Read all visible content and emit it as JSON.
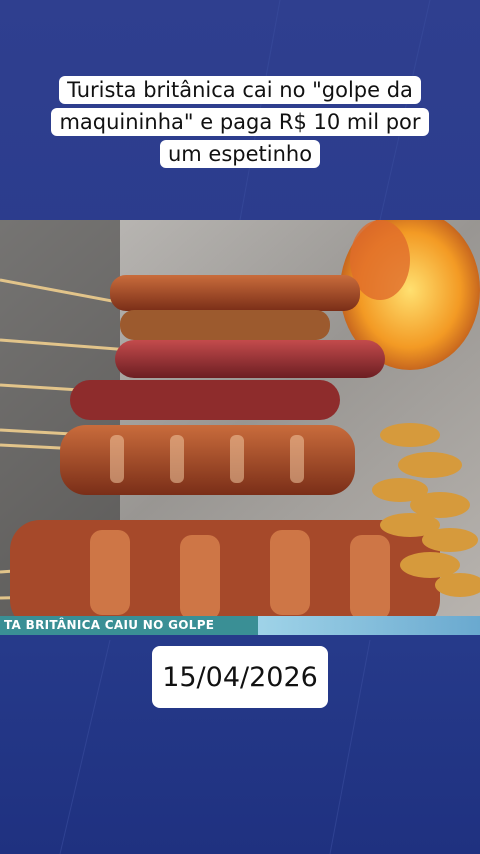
{
  "headline": "Turista britânica cai no \"golpe da maquininha\" e paga R$ 10 mil por um espetinho",
  "ticker_text": "TA BRITÂNICA CAIU NO GOLPE",
  "date": "15/04/2026",
  "colors": {
    "background": "#2a3b8c",
    "ticker": "#3a8f95"
  }
}
